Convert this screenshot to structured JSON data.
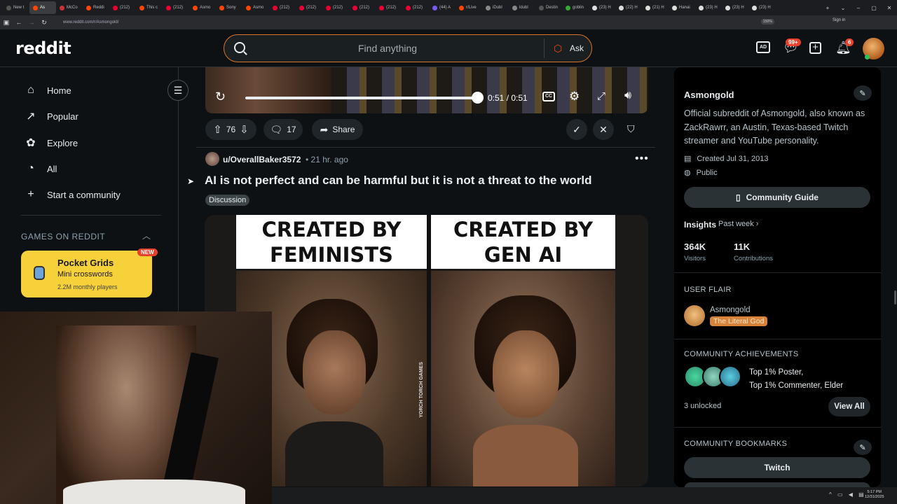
{
  "browser": {
    "tabs": [
      "New t",
      "As",
      "McCo",
      "Reddi",
      "(212)",
      "This c",
      "(212)",
      "Asmo",
      "Sony",
      "Asmo",
      "(212)",
      "(212)",
      "(212)",
      "(212)",
      "(212)",
      "(212)",
      "(44) A",
      "r/Live",
      "iDubl",
      "ldubl",
      "Destin",
      "goblin",
      "(23) H",
      "(22) H",
      "(21) H",
      "Hanai",
      "(23) H",
      "(23) H",
      "(23) H"
    ],
    "url": "www.reddit.com/r/Asmongold/",
    "zoom": "150%",
    "signin": "Sign in",
    "new_tab": "+",
    "window_controls": {
      "tabsearch": "⌄",
      "minimize": "–",
      "maximize": "▢",
      "close": "✕"
    }
  },
  "header": {
    "logo": "reddit",
    "search_placeholder": "Find anything",
    "ask_label": "Ask",
    "chat_badge": "99+",
    "notif_badge": "6"
  },
  "sidebar": {
    "items": [
      {
        "label": "Home",
        "icon": "home-icon"
      },
      {
        "label": "Popular",
        "icon": "popular-icon"
      },
      {
        "label": "Explore",
        "icon": "explore-icon"
      },
      {
        "label": "All",
        "icon": "all-icon"
      },
      {
        "label": "Start a community",
        "icon": "plus-icon"
      }
    ],
    "games_heading": "GAMES ON REDDIT",
    "game": {
      "title": "Pocket Grids",
      "subtitle": "Mini crosswords",
      "players": "2.2M monthly players",
      "badge": "NEW"
    }
  },
  "video": {
    "time": "0:51 / 0:51",
    "progress": 1.0
  },
  "post_actions": {
    "votes": "76",
    "comments": "17",
    "share": "Share"
  },
  "post": {
    "author": "u/OverallBaker3572",
    "time": "• 21 hr. ago",
    "more": "•••",
    "title": "AI is not perfect and can be harmful but it is not a threat to the world",
    "flair": "Discussion",
    "meme_left": "CREATED BY\nFEMINISTS",
    "meme_right": "CREATED BY\nGEN AI",
    "meme_watermark": "YORCH TORCH GAMES"
  },
  "community": {
    "name": "Asmongold",
    "description": "Official subreddit of Asmongold, also known as ZackRawrr, an Austin, Texas-based Twitch streamer and YouTube personality.",
    "created": "Created Jul 31, 2013",
    "visibility": "Public",
    "guide_label": "Community Guide",
    "insights_label": "Insights",
    "insights_period": "Past week ›",
    "visitors_num": "364K",
    "visitors_label": "Visitors",
    "contrib_num": "11K",
    "contrib_label": "Contributions",
    "user_flair_heading": "USER FLAIR",
    "flair_user": "Asmongold",
    "flair_text": "The Literal God",
    "achievements_heading": "COMMUNITY ACHIEVEMENTS",
    "achievements_line1": "Top 1% Poster,",
    "achievements_line2": "Top 1% Commenter, Elder",
    "unlocked": "3 unlocked",
    "view_all": "View All",
    "bookmarks_heading": "COMMUNITY BOOKMARKS",
    "bookmark1": "Twitch"
  },
  "taskbar": {
    "time": "5:17 PM",
    "date": "12/31/2025",
    "tray": "^ ▭ ◀ ▤"
  },
  "colors": {
    "accent": "#ff4500",
    "search_border": "#d9752a",
    "game_card": "#f7d13a",
    "badge": "#e8412b",
    "flair_bg": "#d7843a"
  }
}
